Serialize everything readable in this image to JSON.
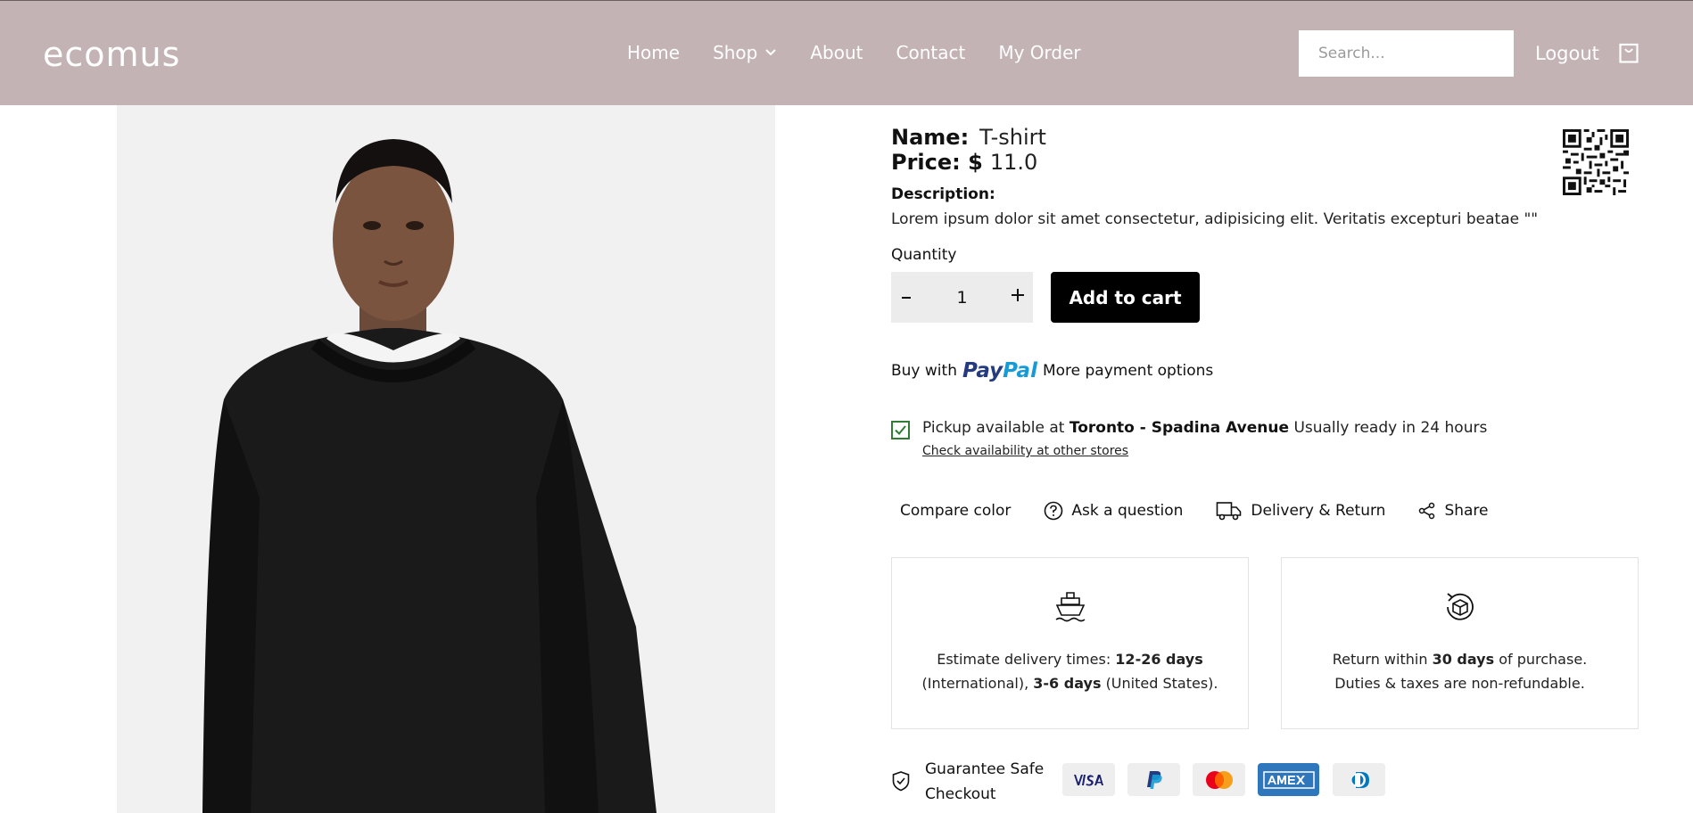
{
  "header": {
    "logo": "ecomus",
    "nav": [
      "Home",
      "Shop",
      "About",
      "Contact",
      "My Order"
    ],
    "search_placeholder": "Search...",
    "logout": "Logout"
  },
  "product": {
    "name_label": "Name:",
    "name": "T-shirt",
    "price_label": "Price: $",
    "price": "11.0",
    "description_label": "Description:",
    "description": "Lorem ipsum dolor sit amet consectetur, adipisicing elit. Veritatis excepturi beatae \"\"",
    "quantity_label": "Quantity",
    "quantity": "1",
    "add_to_cart": "Add to cart"
  },
  "payment": {
    "buy_with": "Buy with",
    "paypal_a": "Pay",
    "paypal_b": "Pal",
    "more_options": "More payment options"
  },
  "pickup": {
    "text_prefix": "Pickup available at",
    "location": "Toronto - Spadina Avenue",
    "text_suffix": "Usually ready in 24 hours",
    "check_link": "Check availability at other stores"
  },
  "actions": [
    "Compare color",
    "Ask a question",
    "Delivery & Return",
    "Share"
  ],
  "cards": {
    "delivery": {
      "p1": "Estimate delivery times:",
      "b1": "12-26 days",
      "p2": "(International),",
      "b2": "3-6 days",
      "p3": "(United States)."
    },
    "return": {
      "p1": "Return within",
      "b1": "30 days",
      "p2": "of purchase.",
      "line2": "Duties & taxes are non-refundable."
    }
  },
  "guarantee": {
    "line1": "Guarantee Safe",
    "line2": "Checkout",
    "cards": [
      "VISA",
      "PayPal",
      "Mastercard",
      "AMEX",
      "Diners Club"
    ]
  },
  "colors": {
    "header_bg": "#c4b3b4",
    "button_bg": "#000000",
    "check_green": "#2e7d32",
    "paypal_dark": "#253b80",
    "paypal_light": "#179bd7"
  }
}
